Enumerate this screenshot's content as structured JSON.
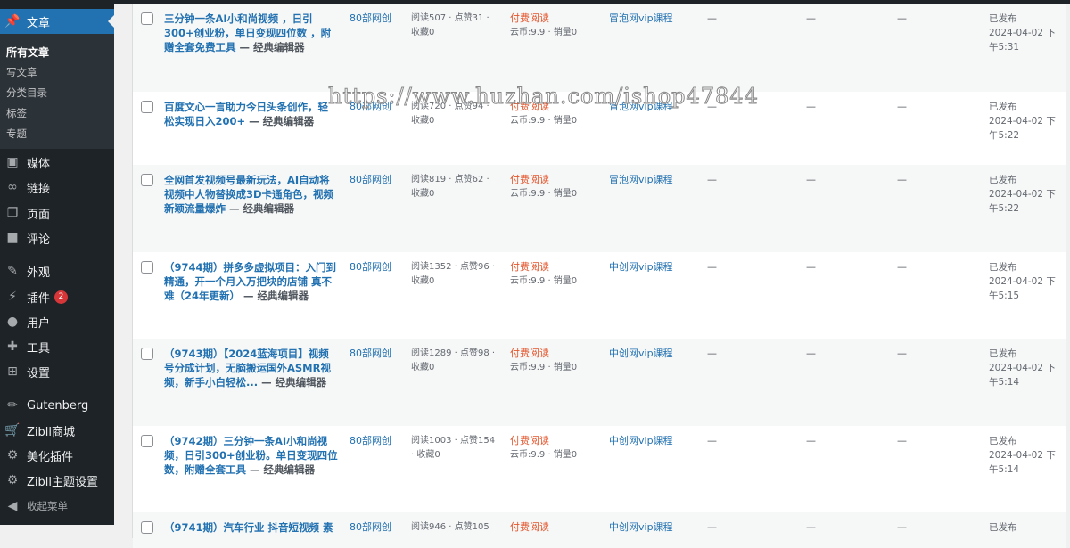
{
  "sidebar": {
    "active": {
      "label": "文章",
      "icon": "pin-icon"
    },
    "submenu": [
      "所有文章",
      "写文章",
      "分类目录",
      "标签",
      "专题"
    ],
    "items": [
      {
        "label": "媒体",
        "icon": "media-icon"
      },
      {
        "label": "链接",
        "icon": "link-icon"
      },
      {
        "label": "页面",
        "icon": "pages-icon"
      },
      {
        "label": "评论",
        "icon": "comment-icon"
      },
      {
        "label": "外观",
        "icon": "brush-icon"
      },
      {
        "label": "插件",
        "icon": "plugin-icon",
        "badge": "2"
      },
      {
        "label": "用户",
        "icon": "user-icon"
      },
      {
        "label": "工具",
        "icon": "wrench-icon"
      },
      {
        "label": "设置",
        "icon": "settings-icon"
      },
      {
        "label": "Gutenberg",
        "icon": "pencil-icon"
      },
      {
        "label": "Zibll商城",
        "icon": "cart-icon"
      },
      {
        "label": "美化插件",
        "icon": "gear-icon"
      },
      {
        "label": "Zibll主题设置",
        "icon": "gear-icon"
      },
      {
        "label": "收起菜单",
        "icon": "collapse-icon"
      }
    ]
  },
  "watermark": "https://www.huzhan.com/ishop47844",
  "posts": [
    {
      "title": "三分钟一条AI小和尚视频 ，日引300+创业粉，单日变现四位数 ，附赠全套免费工具",
      "editor": " — 经典编辑器",
      "author": "80部网创",
      "stats": "阅读507 · 点赞31 · 收藏0",
      "pay": "付费阅读",
      "price": "云币:9.9 · 销量0",
      "category": "冒泡网vip课程",
      "d1": "—",
      "d2": "—",
      "d3": "—",
      "status": "已发布",
      "date": "2024-04-02 下午5:31"
    },
    {
      "title": "百度文心一言助力今日头条创作，轻松实现日入200+",
      "editor": " — 经典编辑器",
      "author": "80部网创",
      "stats": "阅读720 · 点赞94 · 收藏0",
      "pay": "付费阅读",
      "price": "云币:9.9 · 销量0",
      "category": "冒泡网vip课程",
      "d1": "—",
      "d2": "—",
      "d3": "—",
      "status": "已发布",
      "date": "2024-04-02 下午5:22"
    },
    {
      "title": "全网首发视频号最新玩法，AI自动将视频中人物替换成3D卡通角色，视频新颖流量爆炸",
      "editor": " — 经典编辑器",
      "author": "80部网创",
      "stats": "阅读819 · 点赞62 · 收藏0",
      "pay": "付费阅读",
      "price": "云币:9.9 · 销量0",
      "category": "冒泡网vip课程",
      "d1": "—",
      "d2": "—",
      "d3": "—",
      "status": "已发布",
      "date": "2024-04-02 下午5:22"
    },
    {
      "title": "（9744期）拼多多虚拟项目：入门到精通，开一个月入万把块的店铺 真不难（24年更新）",
      "editor": " — 经典编辑器",
      "author": "80部网创",
      "stats": "阅读1352 · 点赞96 · 收藏0",
      "pay": "付费阅读",
      "price": "云币:9.9 · 销量0",
      "category": "中创网vip课程",
      "d1": "—",
      "d2": "—",
      "d3": "—",
      "status": "已发布",
      "date": "2024-04-02 下午5:15"
    },
    {
      "title": "（9743期）【2024蓝海项目】视频号分成计划，无脑搬运国外ASMR视频，新手小白轻松...",
      "editor": " — 经典编辑器",
      "author": "80部网创",
      "stats": "阅读1289 · 点赞98 · 收藏0",
      "pay": "付费阅读",
      "price": "云币:9.9 · 销量0",
      "category": "中创网vip课程",
      "d1": "—",
      "d2": "—",
      "d3": "—",
      "status": "已发布",
      "date": "2024-04-02 下午5:14"
    },
    {
      "title": "（9742期）三分钟一条AI小和尚视频，日引300+创业粉。单日变现四位数，附赠全套工具",
      "editor": " — 经典编辑器",
      "author": "80部网创",
      "stats": "阅读1003 · 点赞154 · 收藏0",
      "pay": "付费阅读",
      "price": "云币:9.9 · 销量0",
      "category": "中创网vip课程",
      "d1": "—",
      "d2": "—",
      "d3": "—",
      "status": "已发布",
      "date": "2024-04-02 下午5:14"
    },
    {
      "title": "（9741期）汽车行业 抖音短视频 素",
      "editor": "",
      "author": "80部网创",
      "stats": "阅读946 · 点赞105",
      "pay": "付费阅读",
      "price": "",
      "category": "中创网vip课程",
      "d1": "—",
      "d2": "—",
      "d3": "—",
      "status": "已发布",
      "date": ""
    }
  ]
}
